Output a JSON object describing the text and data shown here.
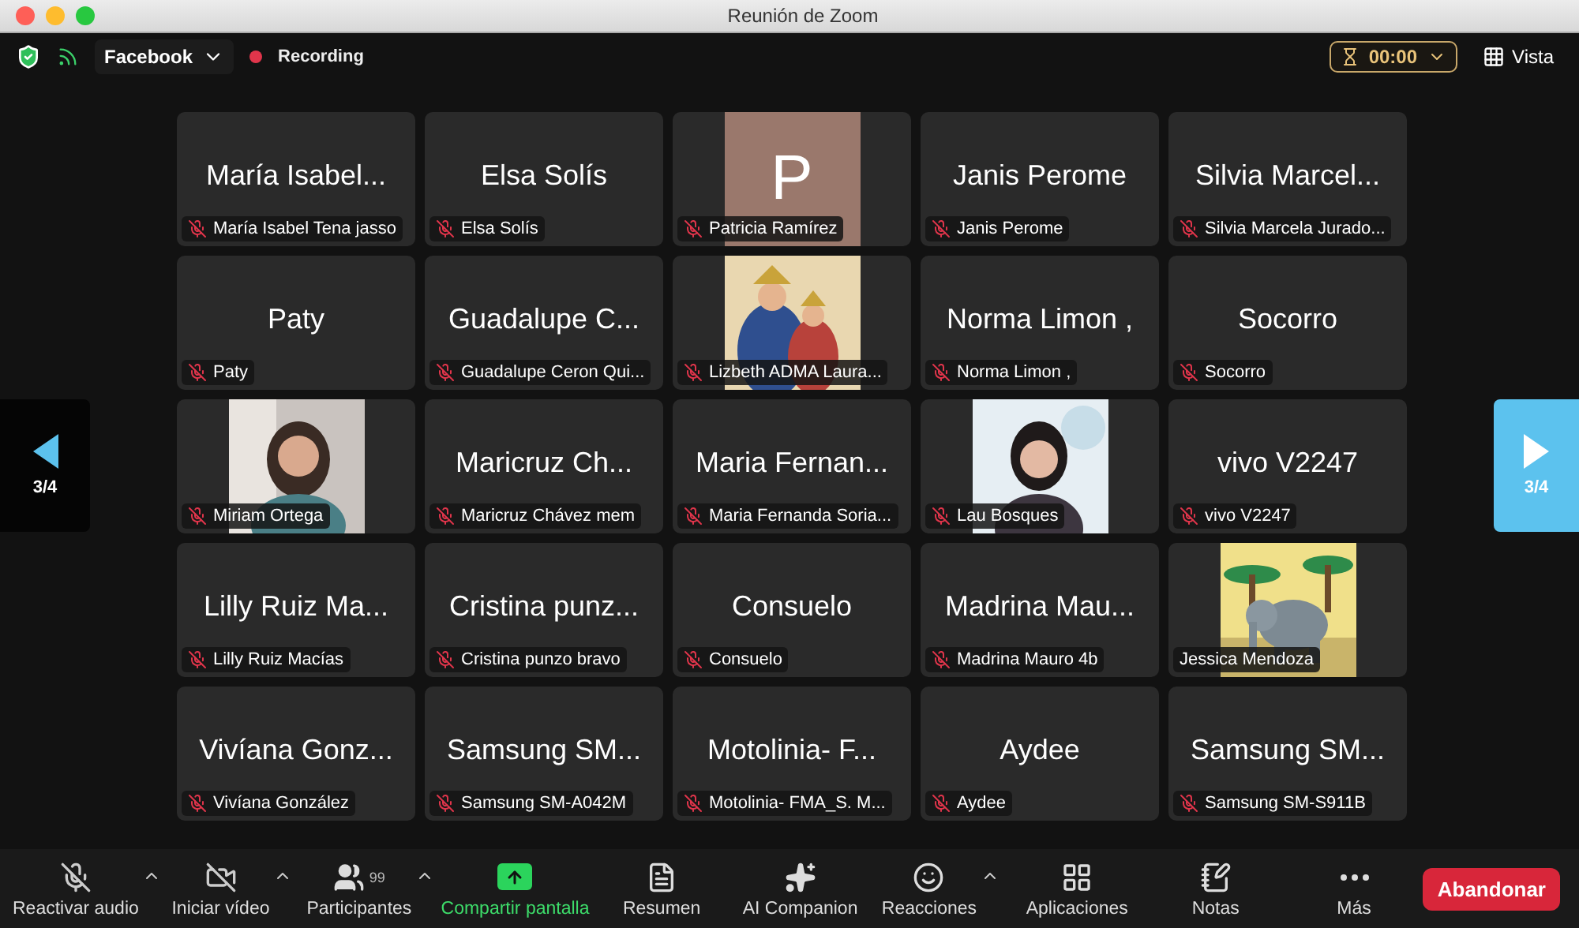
{
  "window": {
    "title": "Reunión de Zoom"
  },
  "top_bar": {
    "stream": "Facebook",
    "recording": "Recording",
    "timer": "00:00",
    "view": "Vista"
  },
  "nav": {
    "prev_page": "3/4",
    "next_page": "3/4"
  },
  "tiles": [
    {
      "kind": "name",
      "display": "María Isabel...",
      "label": "María Isabel Tena jasso",
      "muted": true
    },
    {
      "kind": "name",
      "display": "Elsa Solís",
      "label": "Elsa Solís",
      "muted": true
    },
    {
      "kind": "avatar",
      "display": "P",
      "label": "Patricia Ramírez",
      "muted": true
    },
    {
      "kind": "name",
      "display": "Janis Perome",
      "label": "Janis Perome",
      "muted": true
    },
    {
      "kind": "name",
      "display": "Silvia Marcel...",
      "label": "Silvia Marcela Jurado...",
      "muted": true
    },
    {
      "kind": "name",
      "display": "Paty",
      "label": "Paty",
      "muted": true
    },
    {
      "kind": "name",
      "display": "Guadalupe C...",
      "label": "Guadalupe Ceron Qui...",
      "muted": true
    },
    {
      "kind": "picture",
      "label": "Lizbeth ADMA Laura...",
      "muted": true
    },
    {
      "kind": "name",
      "display": "Norma Limon ,",
      "label": "Norma Limon ,",
      "muted": true
    },
    {
      "kind": "name",
      "display": "Socorro",
      "label": "Socorro",
      "muted": true
    },
    {
      "kind": "picture",
      "label": "Miriam Ortega",
      "muted": true
    },
    {
      "kind": "name",
      "display": "Maricruz Ch...",
      "label": "Maricruz Chávez mem",
      "muted": true
    },
    {
      "kind": "name",
      "display": "Maria Fernan...",
      "label": "Maria Fernanda Soria...",
      "muted": true
    },
    {
      "kind": "picture",
      "label": "Lau Bosques",
      "muted": true
    },
    {
      "kind": "name",
      "display": "vivo V2247",
      "label": "vivo V2247",
      "muted": true
    },
    {
      "kind": "name",
      "display": "Lilly Ruiz Ma...",
      "label": "Lilly Ruiz Macías",
      "muted": true
    },
    {
      "kind": "name",
      "display": "Cristina punz...",
      "label": "Cristina punzo bravo",
      "muted": true
    },
    {
      "kind": "name",
      "display": "Consuelo",
      "label": "Consuelo",
      "muted": true
    },
    {
      "kind": "name",
      "display": "Madrina Mau...",
      "label": "Madrina Mauro 4b",
      "muted": true
    },
    {
      "kind": "picture",
      "label": "Jessica Mendoza",
      "muted": false
    },
    {
      "kind": "name",
      "display": "Vivíana Gonz...",
      "label": "Vivíana González",
      "muted": true
    },
    {
      "kind": "name",
      "display": "Samsung SM...",
      "label": "Samsung SM-A042M",
      "muted": true
    },
    {
      "kind": "name",
      "display": "Motolinia- F...",
      "label": "Motolinia- FMA_S. M...",
      "muted": true
    },
    {
      "kind": "name",
      "display": "Aydee",
      "label": "Aydee",
      "muted": true
    },
    {
      "kind": "name",
      "display": "Samsung SM...",
      "label": "Samsung SM-S911B",
      "muted": true
    }
  ],
  "toolbar": [
    {
      "kind": "mic",
      "label": "Reactivar audio",
      "caret": true
    },
    {
      "kind": "video",
      "label": "Iniciar vídeo",
      "caret": true
    },
    {
      "kind": "participants",
      "label": "Participantes",
      "count": "99",
      "caret": true
    },
    {
      "kind": "share",
      "label": "Compartir pantalla",
      "caret": false
    },
    {
      "kind": "summary",
      "label": "Resumen",
      "caret": false
    },
    {
      "kind": "ai",
      "label": "AI Companion",
      "caret": false
    },
    {
      "kind": "reactions",
      "label": "Reacciones",
      "caret": true
    },
    {
      "kind": "apps",
      "label": "Aplicaciones",
      "caret": false
    },
    {
      "kind": "notes",
      "label": "Notas",
      "caret": false
    },
    {
      "kind": "more",
      "label": "Más",
      "caret": false
    }
  ],
  "leave_button": "Abandonar"
}
